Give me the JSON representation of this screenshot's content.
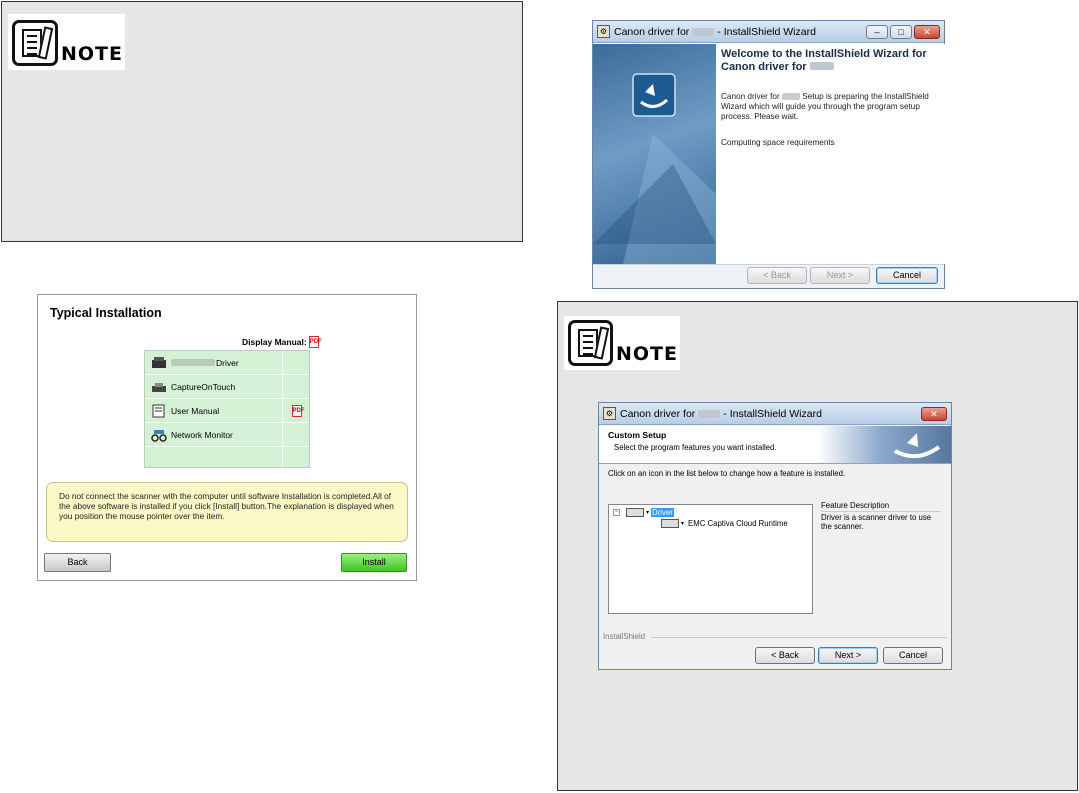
{
  "note_label": "NOTE",
  "wizard1": {
    "title_pre": "Canon driver for",
    "title_post": "- InstallShield Wizard",
    "heading": "Welcome to the InstallShield Wizard for Canon driver for",
    "body_pre": "Canon driver for",
    "body_post": "Setup is preparing the InstallShield Wizard which will guide you through the program setup process.  Please wait.",
    "status": "Computing space requirements",
    "back_label": "< Back",
    "next_label": "Next >",
    "cancel_label": "Cancel"
  },
  "typical": {
    "title": "Typical Installation",
    "display_manual": "Display Manual:",
    "items": [
      {
        "label": "Driver",
        "icon": "scanner-icon"
      },
      {
        "label": "CaptureOnTouch",
        "icon": "capture-icon"
      },
      {
        "label": "User Manual",
        "icon": "manual-icon"
      },
      {
        "label": "Network Monitor",
        "icon": "network-icon"
      }
    ],
    "message": "Do not connect the scanner with the computer until software Installation is completed.All of the above software is installed if you click [Install] button.The explanation is displayed when you position the mouse pointer over the item.",
    "back_label": "Back",
    "install_label": "Install"
  },
  "wizard2": {
    "title_pre": "Canon driver for",
    "title_post": "- InstallShield Wizard",
    "header_title": "Custom Setup",
    "header_sub": "Select the program features you want installed.",
    "instruction": "Click on an icon in the list below to change how a feature is installed.",
    "tree_root": "Driver",
    "tree_child": "EMC Captiva Cloud Runtime",
    "desc_title": "Feature Description",
    "desc_text": "Driver is a scanner driver to use the scanner.",
    "installshield": "InstallShield",
    "back_label": "< Back",
    "next_label": "Next >",
    "cancel_label": "Cancel"
  }
}
